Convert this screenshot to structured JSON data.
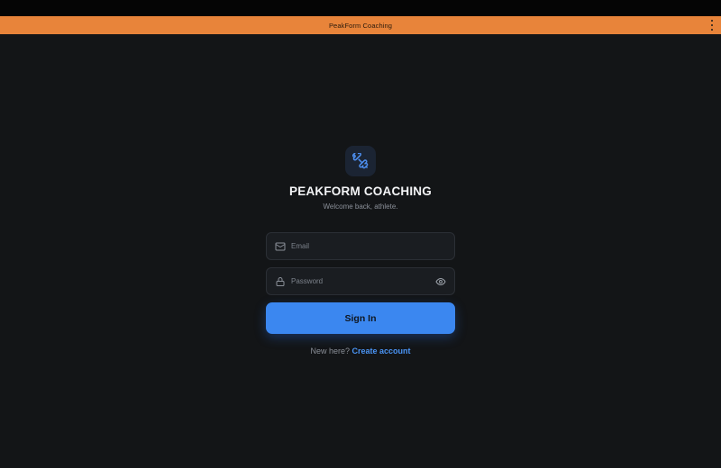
{
  "window": {
    "title": "PeakForm Coaching",
    "menu_icon": "more-vertical-icon"
  },
  "colors": {
    "titlebar": "#e8843a",
    "background": "#131517",
    "accent": "#3b87f0",
    "link": "#4a94f5"
  },
  "login": {
    "logo_icon": "dumbbell-icon",
    "brand": "PEAKFORM COACHING",
    "tagline": "Welcome back, athlete.",
    "email": {
      "icon": "mail-icon",
      "placeholder": "Email",
      "value": ""
    },
    "password": {
      "icon": "lock-icon",
      "placeholder": "Password",
      "value": "",
      "toggle_icon": "eye-icon"
    },
    "submit_label": "Sign In",
    "signup_prompt": "New here?",
    "signup_link": "Create account"
  }
}
